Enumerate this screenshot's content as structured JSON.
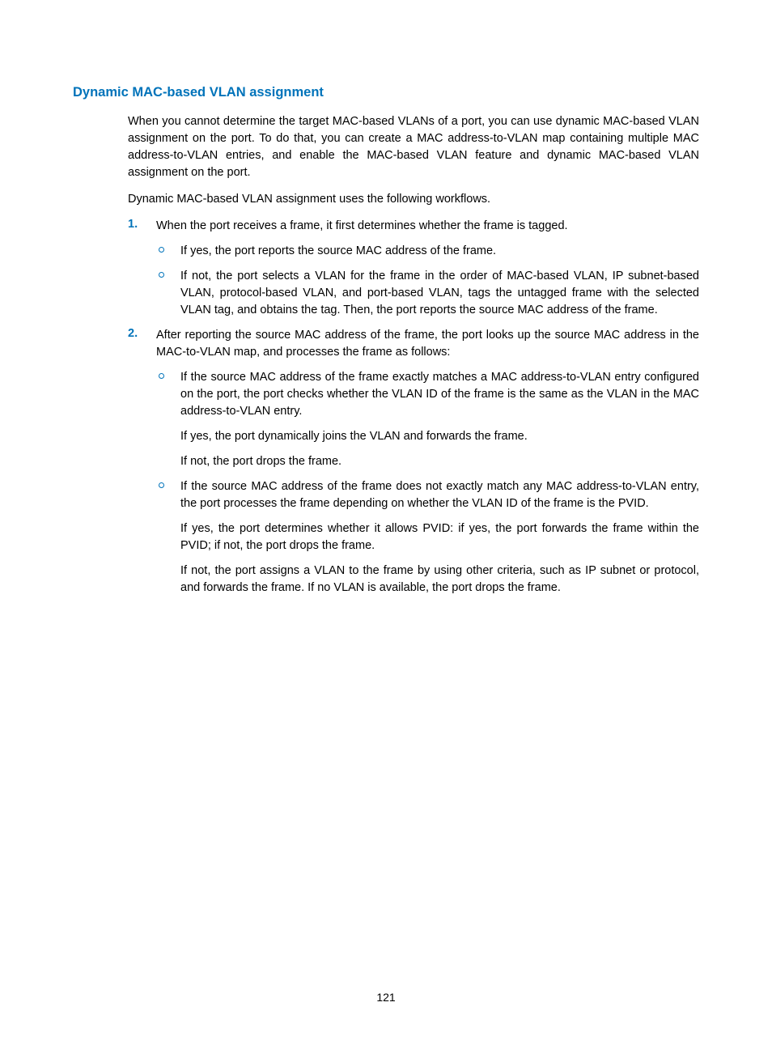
{
  "heading": "Dynamic MAC-based VLAN assignment",
  "intro1": "When you cannot determine the target MAC-based VLANs of a port, you can use dynamic MAC-based VLAN assignment on the port. To do that, you can create a MAC address-to-VLAN map containing multiple MAC address-to-VLAN entries, and enable the MAC-based VLAN feature and dynamic MAC-based VLAN assignment on the port.",
  "intro2": "Dynamic MAC-based VLAN assignment uses the following workflows.",
  "items": [
    {
      "num": "1.",
      "text": "When the port receives a frame, it first determines whether the frame is tagged.",
      "subitems": [
        {
          "text": "If yes, the port reports the source MAC address of the frame."
        },
        {
          "text": "If not, the port selects a VLAN for the frame in the order of MAC-based VLAN, IP subnet-based VLAN, protocol-based VLAN, and port-based VLAN, tags the untagged frame with the selected VLAN tag, and obtains the tag. Then, the port reports the source MAC address of the frame."
        }
      ]
    },
    {
      "num": "2.",
      "text": "After reporting the source MAC address of the frame, the port looks up the source MAC address in the MAC-to-VLAN map, and processes the frame as follows:",
      "subitems": [
        {
          "text": "If the source MAC address of the frame exactly matches a MAC address-to-VLAN entry configured on the port, the port checks whether the VLAN ID of the frame is the same as the VLAN in the MAC address-to-VLAN entry.",
          "extras": [
            "If yes, the port dynamically joins the VLAN and forwards the frame.",
            "If not, the port drops the frame."
          ]
        },
        {
          "text": "If the source MAC address of the frame does not exactly match any MAC address-to-VLAN entry, the port processes the frame depending on whether the VLAN ID of the frame is the PVID.",
          "extras": [
            "If yes, the port determines whether it allows PVID: if yes, the port forwards the frame within the PVID; if not, the port drops the frame.",
            "If not, the port assigns a VLAN to the frame by using other criteria, such as IP subnet or protocol, and forwards the frame. If no VLAN is available, the port drops the frame."
          ]
        }
      ]
    }
  ],
  "pageNumber": "121"
}
